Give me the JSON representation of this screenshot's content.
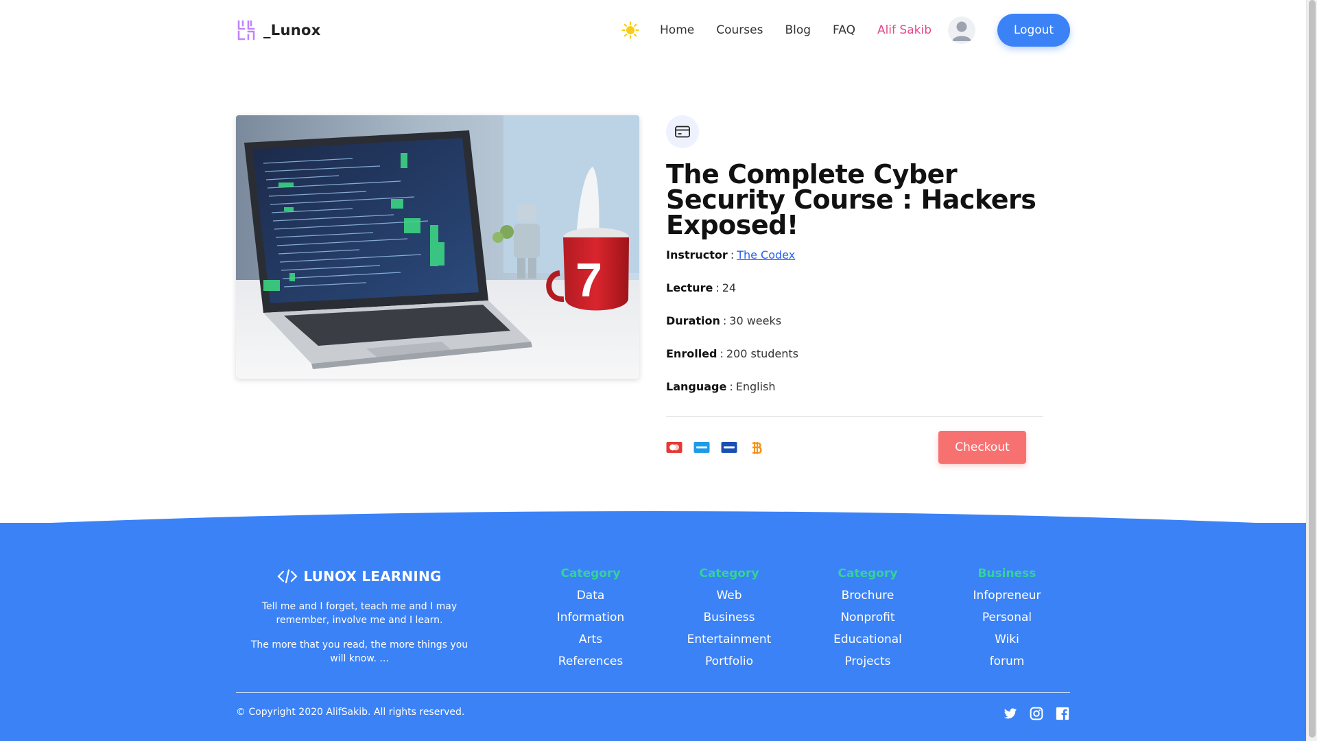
{
  "header": {
    "brand_name": "_Lunox",
    "nav": [
      "Home",
      "Courses",
      "Blog",
      "FAQ"
    ],
    "user_name": "Alif Sakib",
    "logout_label": "Logout"
  },
  "course": {
    "title": "The Complete Cyber Security Course : Hackers Exposed!",
    "instructor_label": "Instructor",
    "instructor_name": "The Codex",
    "lecture_label": "Lecture",
    "lecture_value": "24",
    "duration_label": "Duration",
    "duration_value": "30 weeks",
    "enrolled_label": "Enrolled",
    "enrolled_value": "200 students",
    "language_label": "Language",
    "language_value": "English",
    "separator": ":",
    "payment_icons": [
      "mastercard-icon",
      "paypal-icon",
      "visa-icon",
      "bitcoin-icon"
    ],
    "checkout_label": "Checkout",
    "mug_number": "7"
  },
  "footer": {
    "brand_title": "LUNOX LEARNING",
    "quote1": "Tell me and I forget, teach me and I may remember, involve me and I learn.",
    "quote2": "The more that you read, the more things you will know. ...",
    "columns": [
      {
        "title": "Category",
        "items": [
          "Data",
          "Information",
          "Arts",
          "References"
        ]
      },
      {
        "title": "Category",
        "items": [
          "Web",
          "Business",
          "Entertainment",
          "Portfolio"
        ]
      },
      {
        "title": "Category",
        "items": [
          "Brochure",
          "Nonprofit",
          "Educational",
          "Projects"
        ]
      },
      {
        "title": "Business",
        "items": [
          "Infopreneur",
          "Personal",
          "Wiki",
          "forum"
        ]
      }
    ],
    "copyright": "© Copyright 2020 AlifSakib. All rights reserved.",
    "social": [
      "twitter-icon",
      "instagram-icon",
      "facebook-icon"
    ]
  },
  "colors": {
    "primary": "#3b82f6",
    "accent_pink": "#e5488b",
    "checkout": "#f87171",
    "footer_heading": "#34d399"
  }
}
